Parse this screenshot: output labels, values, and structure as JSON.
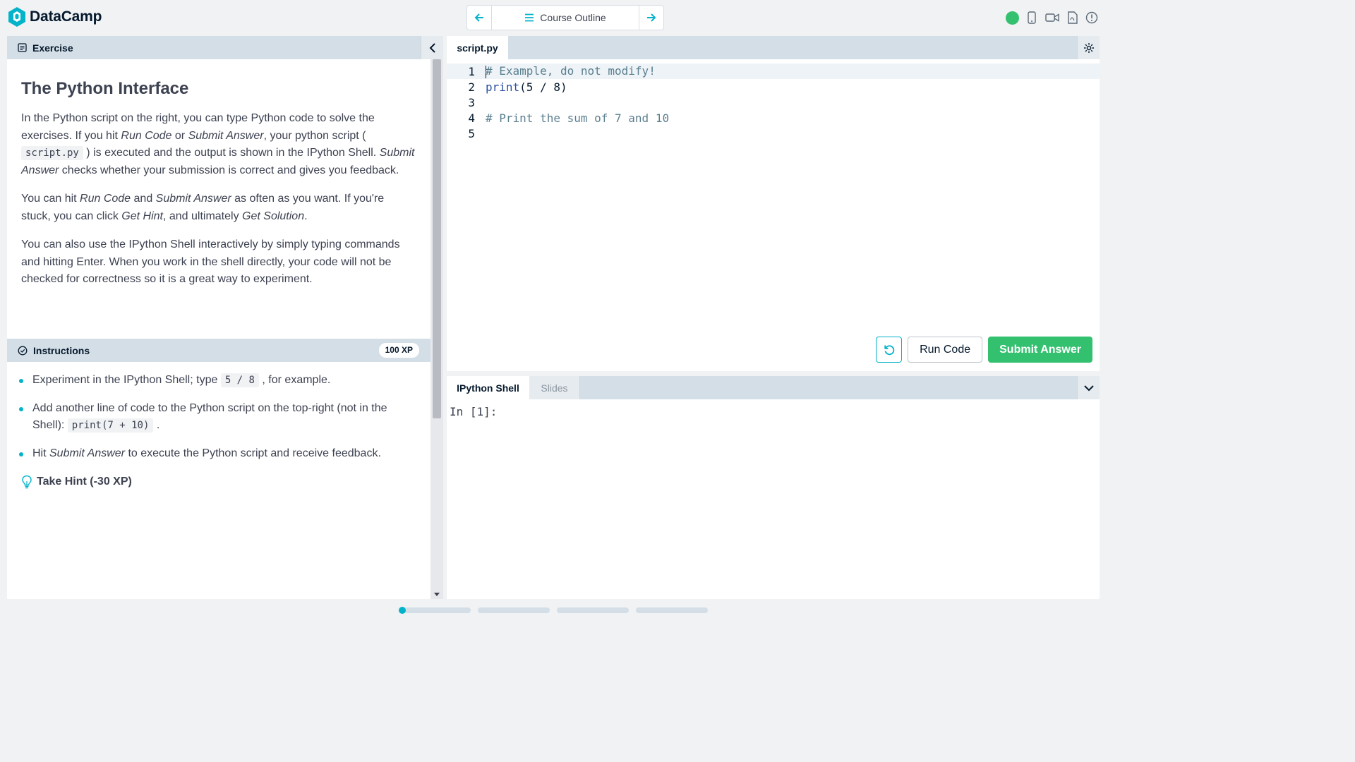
{
  "app": {
    "logo_text": "DataCamp"
  },
  "nav": {
    "center_label": "Course Outline"
  },
  "status": {
    "color": "#33c170"
  },
  "exercise": {
    "header_label": "Exercise",
    "title": "The Python Interface",
    "p1": {
      "t1": "In the Python script on the right, you can type Python code to solve the exercises. If you hit ",
      "e1": "Run Code",
      "t2": " or ",
      "e2": "Submit Answer",
      "t3": ", your python script ( ",
      "code": "script.py",
      "t4": " ) is executed and the output is shown in the IPython Shell. ",
      "e3": "Submit Answer",
      "t5": " checks whether your submission is correct and gives you feedback."
    },
    "p2": {
      "t1": "You can hit ",
      "e1": "Run Code",
      "t2": " and ",
      "e2": "Submit Answer",
      "t3": " as often as you want. If you're stuck, you can click ",
      "e3": "Get Hint",
      "t4": ", and ultimately ",
      "e4": "Get Solution",
      "t5": "."
    },
    "p3": "You can also use the IPython Shell interactively by simply typing commands and hitting Enter. When you work in the shell directly, your code will not be checked for correctness so it is a great way to experiment."
  },
  "instructions": {
    "header_label": "Instructions",
    "xp": "100 XP",
    "items": [
      {
        "t1": "Experiment in the IPython Shell; type ",
        "code": "5 / 8",
        "t2": " , for example."
      },
      {
        "t1": "Add another line of code to the Python script on the top-right (not in the Shell): ",
        "code": "print(7 + 10)",
        "t2": " ."
      },
      {
        "t1": "Hit ",
        "em": "Submit Answer",
        "t2": " to execute the Python script and receive feedback."
      }
    ],
    "hint_label": "Take Hint (-30 XP)"
  },
  "editor": {
    "tab_label": "script.py",
    "lines": [
      {
        "num": "1",
        "text": "# Example, do not modify!"
      },
      {
        "num": "2",
        "func": "print",
        "rest": "(5 / 8)"
      },
      {
        "num": "3",
        "text": ""
      },
      {
        "num": "4",
        "text": "# Print the sum of 7 and 10"
      },
      {
        "num": "5",
        "text": ""
      }
    ],
    "run_label": "Run Code",
    "submit_label": "Submit Answer"
  },
  "shell": {
    "tabs": [
      "IPython Shell",
      "Slides"
    ],
    "prompt": "In [1]:"
  },
  "progress": {
    "steps": 4,
    "current_step": 1
  }
}
